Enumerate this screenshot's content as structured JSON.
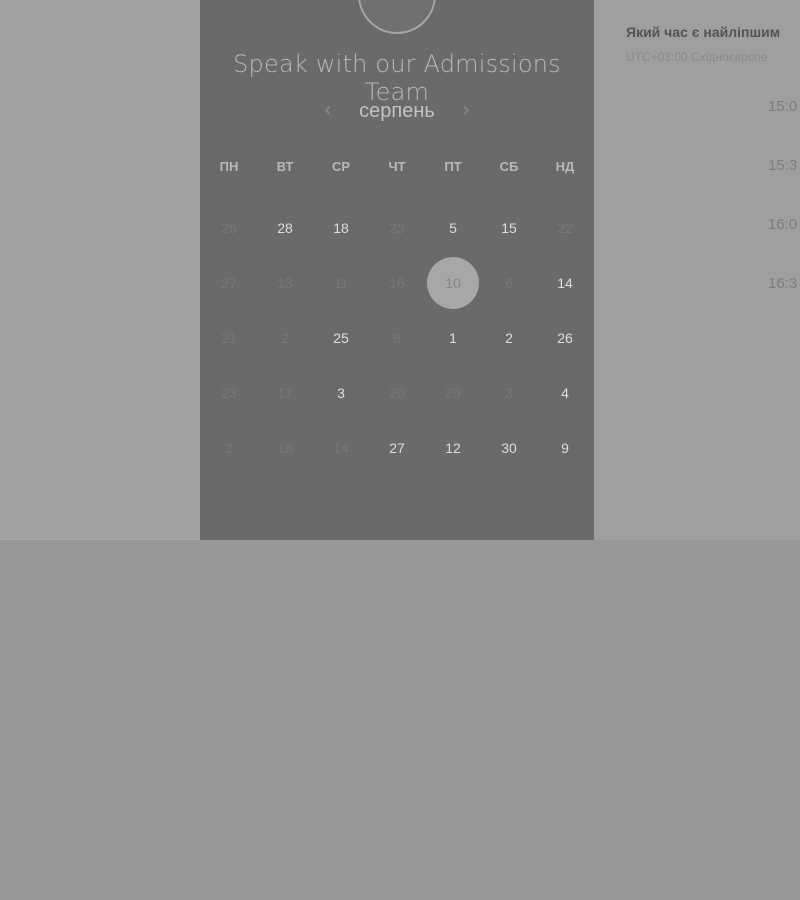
{
  "panel": {
    "avatar_text": "",
    "title": "Speak with our Admissions Team",
    "month": "серпень",
    "prev_icon": "chevron-left-icon",
    "next_icon": "chevron-right-icon"
  },
  "weekdays": [
    "ПН",
    "ВТ",
    "СР",
    "ЧТ",
    "ПТ",
    "СБ",
    "НД"
  ],
  "weeks": [
    [
      {
        "d": "26",
        "s": "dim"
      },
      {
        "d": "28",
        "s": "active"
      },
      {
        "d": "18",
        "s": "active"
      },
      {
        "d": "23",
        "s": "dim"
      },
      {
        "d": "5",
        "s": "active"
      },
      {
        "d": "15",
        "s": "active"
      },
      {
        "d": "22",
        "s": "dim"
      }
    ],
    [
      {
        "d": "27",
        "s": "dim"
      },
      {
        "d": "13",
        "s": "dim"
      },
      {
        "d": "11",
        "s": "dim"
      },
      {
        "d": "16",
        "s": "dim"
      },
      {
        "d": "10",
        "s": "selected"
      },
      {
        "d": "6",
        "s": "dim"
      },
      {
        "d": "14",
        "s": "active"
      }
    ],
    [
      {
        "d": "21",
        "s": "dim"
      },
      {
        "d": "2",
        "s": "dim"
      },
      {
        "d": "25",
        "s": "active"
      },
      {
        "d": "8",
        "s": "dim"
      },
      {
        "d": "1",
        "s": "active"
      },
      {
        "d": "2",
        "s": "active"
      },
      {
        "d": "26",
        "s": "active"
      }
    ],
    [
      {
        "d": "23",
        "s": "dim"
      },
      {
        "d": "17",
        "s": "dim"
      },
      {
        "d": "3",
        "s": "active"
      },
      {
        "d": "20",
        "s": "dim"
      },
      {
        "d": "29",
        "s": "dim"
      },
      {
        "d": "3",
        "s": "dim"
      },
      {
        "d": "4",
        "s": "active"
      }
    ],
    [
      {
        "d": "2",
        "s": "dim"
      },
      {
        "d": "18",
        "s": "dim"
      },
      {
        "d": "14",
        "s": "dim"
      },
      {
        "d": "27",
        "s": "active"
      },
      {
        "d": "12",
        "s": "active"
      },
      {
        "d": "30",
        "s": "active"
      },
      {
        "d": "9",
        "s": "active"
      }
    ]
  ],
  "right": {
    "question": "Який час є найліпшим",
    "timezone": "UTC+03:00 Східноєвропе",
    "slots": [
      "15:0",
      "15:3",
      "16:0",
      "16:3"
    ]
  }
}
